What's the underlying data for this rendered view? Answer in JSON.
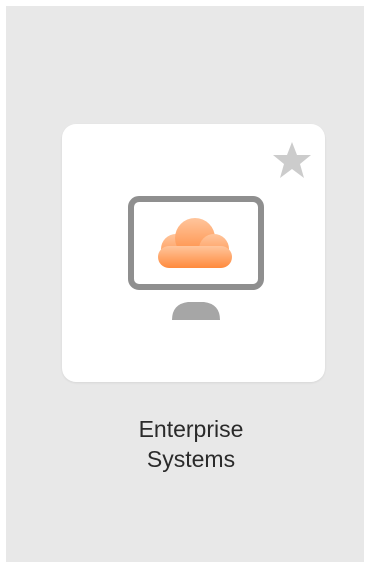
{
  "app": {
    "label_line1": "Enterprise",
    "label_line2": "Systems",
    "icon": "cloud-monitor-icon",
    "favorite_icon": "star-icon",
    "favorited": false
  },
  "colors": {
    "background": "#e8e8e8",
    "tile": "#ffffff",
    "monitor_frame": "#8f8f8f",
    "monitor_stand": "#a6a6a6",
    "cloud_light": "#ffc59c",
    "cloud_dark": "#ff8a3d",
    "star": "#cccccc",
    "text": "#2a2a2a"
  }
}
